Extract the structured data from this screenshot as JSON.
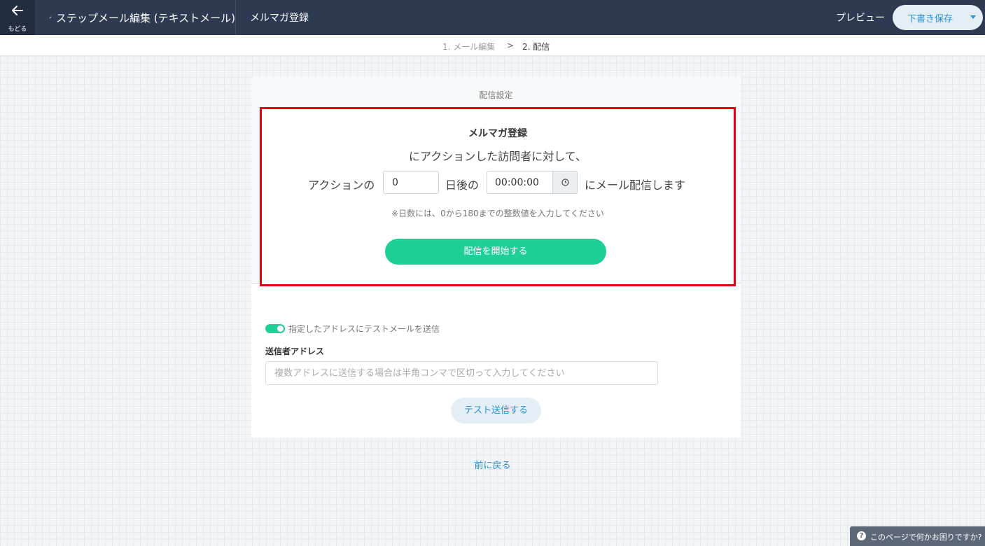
{
  "header": {
    "back_label": "もどる",
    "edit_title": "ステップメール編集 (テキストメール)",
    "form_tab": "メルマガ登録",
    "preview_label": "プレビュー",
    "save_label": "下書き保存"
  },
  "steps": {
    "step1": "1. メール編集",
    "separator": ">",
    "step2": "2. 配信"
  },
  "settings": {
    "title": "配信設定",
    "form_name": "メルマガ登録",
    "action_text": "にアクションした訪問者に対して、",
    "prefix": "アクションの",
    "days_value": "0",
    "days_suffix": "日後の",
    "time_value": "00:00:00",
    "suffix": "にメール配信します",
    "note": "※日数には、0から180までの整数値を入力してください",
    "start_button": "配信を開始する"
  },
  "test": {
    "toggle_label": "指定したアドレスにテストメールを送信",
    "toggle_on": true,
    "sender_label": "送信者アドレス",
    "address_placeholder": "複数アドレスに送信する場合は半角コンマで区切って入力してください",
    "send_button": "テスト送信する"
  },
  "footer": {
    "back_link": "前に戻る",
    "help_text": "このページで何かお困りですか?"
  },
  "colors": {
    "header_bg": "#2e3a52",
    "accent_green": "#1fcf98",
    "link_blue": "#2a8fd0",
    "highlight_red": "#e60012"
  }
}
